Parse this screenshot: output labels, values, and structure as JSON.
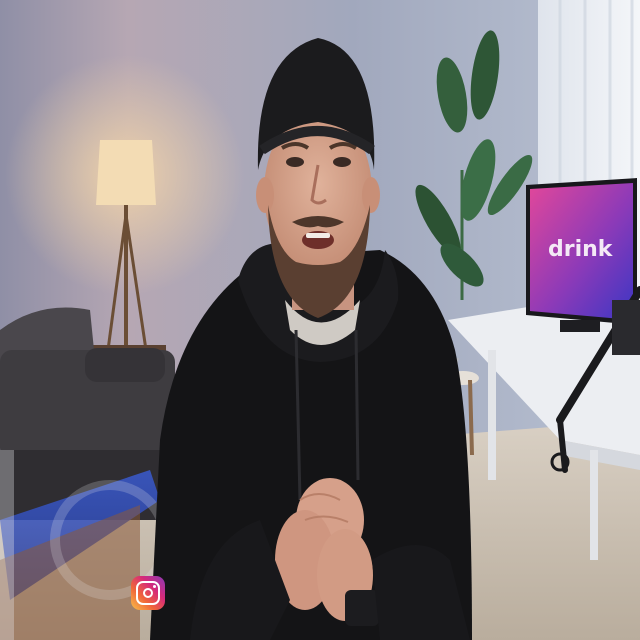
{
  "scene": {
    "monitor_wallpaper_text": "drink",
    "palette": {
      "wall": "#9aa3b9",
      "wall_warm": "#b9a9b5",
      "hoodie": "#141416",
      "beanie": "#1b1b1d",
      "skin": "#d7a48c",
      "beard": "#5a3f31",
      "monitor_screen_start": "#d83f9d",
      "monitor_screen_end": "#4636c8",
      "desk": "#eceef2",
      "sofa": "#3e3c40",
      "lamp_glow": "#f4d4a6",
      "plant": "#2f5a3a"
    },
    "icons": [
      "instagram-icon"
    ]
  }
}
